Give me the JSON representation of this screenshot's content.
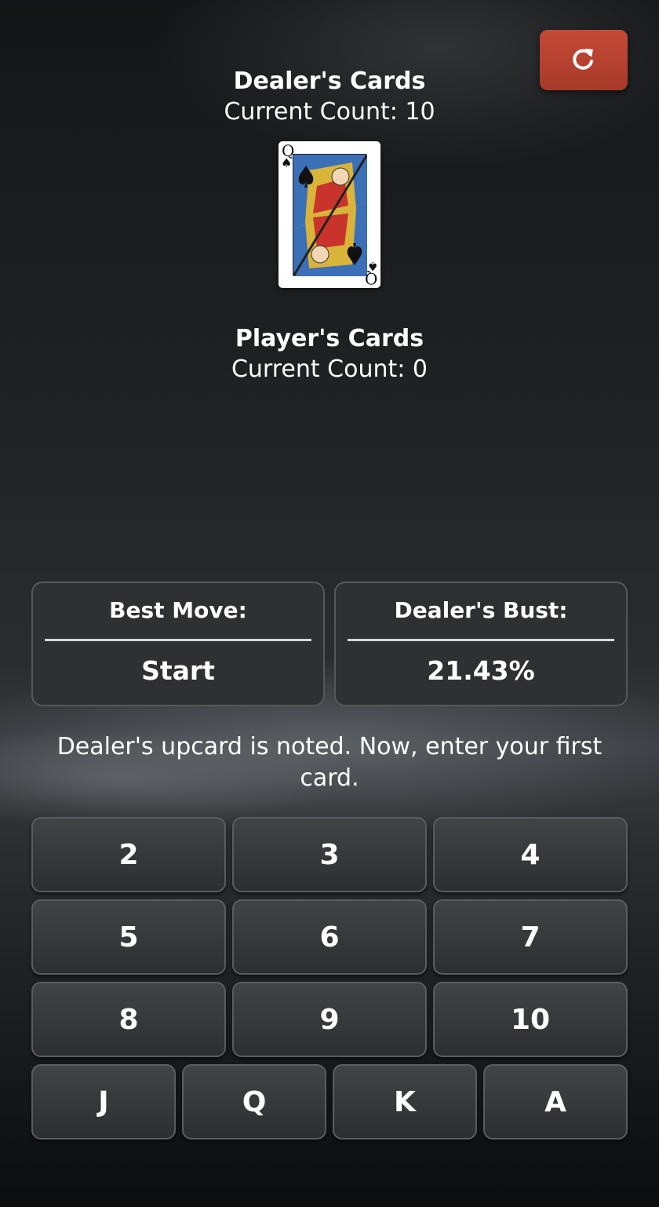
{
  "reset": {
    "icon": "refresh-icon",
    "color": "#b94130"
  },
  "dealer": {
    "title": "Dealer's Cards",
    "count_label": "Current Count: 10",
    "cards": [
      {
        "rank": "Q",
        "suit": "♠",
        "name": "queen-of-spades"
      }
    ]
  },
  "player": {
    "title": "Player's Cards",
    "count_label": "Current Count: 0",
    "cards": []
  },
  "best_move": {
    "label": "Best Move:",
    "value": "Start"
  },
  "dealer_bust": {
    "label": "Dealer's Bust:",
    "value": "21.43%"
  },
  "message": "Dealer's upcard is noted. Now, enter your first card.",
  "keypad": {
    "row1": [
      "2",
      "3",
      "4"
    ],
    "row2": [
      "5",
      "6",
      "7"
    ],
    "row3": [
      "8",
      "9",
      "10"
    ],
    "row4": [
      "J",
      "Q",
      "K",
      "A"
    ]
  }
}
